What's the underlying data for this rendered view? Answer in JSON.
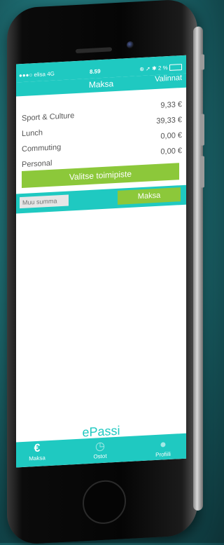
{
  "status": {
    "carrier": "●●●○ elisa  4G",
    "time": "8.59",
    "battery": "⊕ ➚ ✱ 2 %"
  },
  "nav": {
    "title": "Maksa",
    "right": "Valinnat"
  },
  "balances": [
    {
      "label": "Sport & Culture",
      "amount": "9,33 €"
    },
    {
      "label": "Lunch",
      "amount": "39,33 €"
    },
    {
      "label": "Commuting",
      "amount": "0,00 €"
    },
    {
      "label": "Personal",
      "amount": "0,00 €"
    }
  ],
  "actions": {
    "choose_location": "Valitse toimipiste",
    "pay": "Maksa"
  },
  "amount_input": {
    "placeholder": "Muu summa"
  },
  "logo": "ePassi",
  "tabs": [
    {
      "label": "Maksa",
      "icon": "euro-icon"
    },
    {
      "label": "Ostot",
      "icon": "clock-icon"
    },
    {
      "label": "Profiili",
      "icon": "person-icon"
    }
  ],
  "colors": {
    "accent": "#1fc9c1",
    "button": "#8cc83a"
  }
}
